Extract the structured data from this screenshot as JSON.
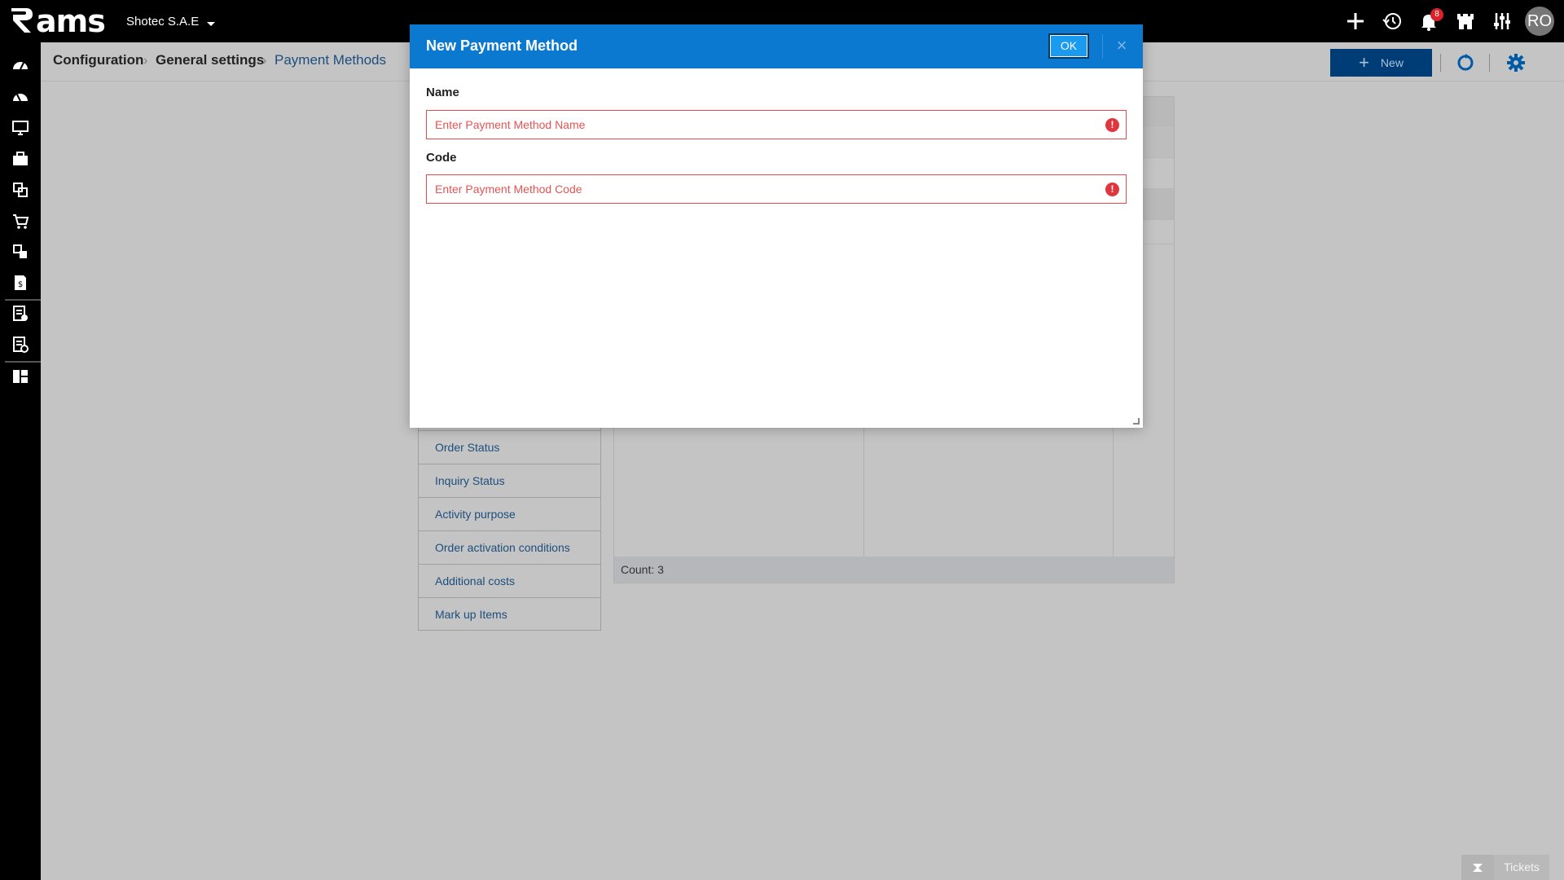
{
  "app": {
    "logo_text": "ams",
    "company": "Shotec S.A.E"
  },
  "topbar": {
    "notifications_count": "8",
    "avatar_initials": "RO"
  },
  "breadcrumb": {
    "items": [
      "Configuration",
      "General settings",
      "Payment Methods"
    ]
  },
  "header": {
    "new_button_label": "New"
  },
  "settings_list": {
    "items": [
      "Order Status",
      "Inquiry Status",
      "Activity purpose",
      "Order activation conditions",
      "Additional costs",
      "Mark up Items"
    ]
  },
  "grid": {
    "count_label": "Count: 3"
  },
  "modal": {
    "title": "New Payment Method",
    "ok_label": "OK",
    "close_symbol": "×",
    "fields": [
      {
        "label": "Name",
        "placeholder": "Enter Payment Method Name",
        "value": "",
        "error": true
      },
      {
        "label": "Code",
        "placeholder": "Enter Payment Method Code",
        "value": "",
        "error": true
      }
    ]
  },
  "tickets": {
    "label": "Tickets"
  },
  "colors": {
    "topbar": "#000000",
    "modal_header": "#0c79d1",
    "ok_button": "#1a9bef",
    "new_button": "#003c75",
    "link": "#1d4e7d",
    "error": "#e84a4a",
    "overlay_bg": "#c4c4c4"
  },
  "icons": {
    "topbar": [
      "plus-icon",
      "history-icon",
      "bell-icon",
      "castle-icon",
      "sliders-icon"
    ],
    "sidebar": [
      "dashboard-icon",
      "speedometer-icon",
      "monitor-icon",
      "briefcase-icon",
      "shapes-icon",
      "cart-icon",
      "boxes-icon",
      "invoice-icon",
      "checklist-icon",
      "report-icon",
      "tiles-icon"
    ],
    "header": [
      "refresh-icon",
      "gear-icon"
    ]
  }
}
